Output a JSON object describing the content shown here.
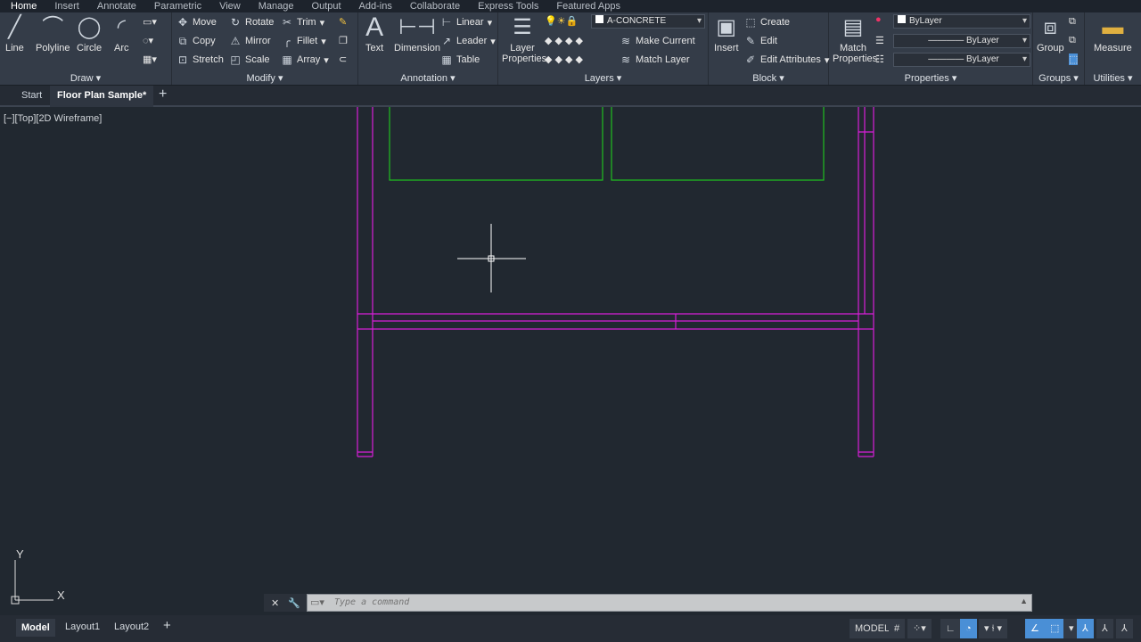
{
  "ribbon_tabs": [
    "Home",
    "Insert",
    "Annotate",
    "Parametric",
    "View",
    "Manage",
    "Output",
    "Add-ins",
    "Collaborate",
    "Express Tools",
    "Featured Apps"
  ],
  "draw": {
    "title": "Draw",
    "line": "Line",
    "polyline": "Polyline",
    "circle": "Circle",
    "arc": "Arc"
  },
  "modify": {
    "title": "Modify",
    "move": "Move",
    "rotate": "Rotate",
    "trim": "Trim",
    "copy": "Copy",
    "mirror": "Mirror",
    "fillet": "Fillet",
    "stretch": "Stretch",
    "scale": "Scale",
    "array": "Array"
  },
  "annotation": {
    "title": "Annotation",
    "text": "Text",
    "dimension": "Dimension",
    "linear": "Linear",
    "leader": "Leader",
    "table": "Table"
  },
  "layers": {
    "title": "Layers",
    "layer_properties": "Layer Properties",
    "current_layer": "A-CONCRETE",
    "make_current": "Make Current",
    "match_layer": "Match Layer"
  },
  "block": {
    "title": "Block",
    "insert": "Insert",
    "create": "Create",
    "edit": "Edit",
    "edit_attributes": "Edit Attributes"
  },
  "properties": {
    "title": "Properties",
    "match_properties": "Match Properties",
    "color": "ByLayer",
    "linetype": "ByLayer",
    "lineweight": "ByLayer"
  },
  "groups": {
    "title": "Groups",
    "group": "Group"
  },
  "utilities": {
    "title": "Utilities",
    "measure": "Measure"
  },
  "file_tabs": {
    "start": "Start",
    "active": "Floor Plan Sample*",
    "add": "+"
  },
  "viewport_label": "[−][Top][2D Wireframe]",
  "ucs": {
    "x": "X",
    "y": "Y"
  },
  "command": {
    "placeholder": "Type a command"
  },
  "layout_tabs": [
    "Model",
    "Layout1",
    "Layout2"
  ],
  "status": {
    "model": "MODEL"
  },
  "colors": {
    "walls": "#d81ed8",
    "fixtures": "#1fbf1f",
    "accent": "#4a8fd6"
  }
}
